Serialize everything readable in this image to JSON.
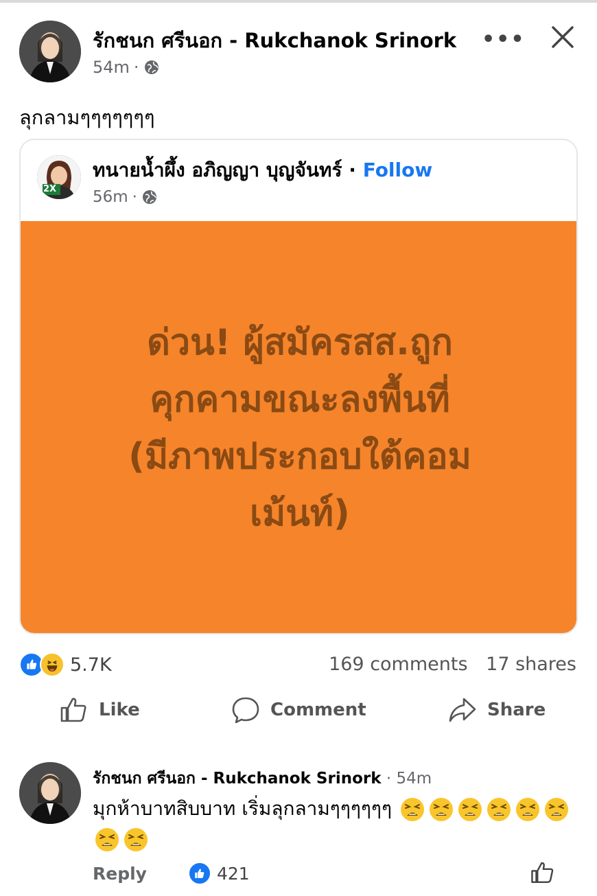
{
  "post": {
    "author": "รักชนก ศรีนอก - Rukchanok Srinork",
    "time": "54m",
    "separator": "·",
    "more_label": "•••",
    "text": "ลุกลามๆๆๆๆๆๆๆ"
  },
  "shared": {
    "author": "ทนายน้ำผึ้ง อภิญญา บุญจันทร์",
    "dot": " · ",
    "follow_label": "Follow",
    "time": "56m",
    "separator": "·",
    "badge": "2X",
    "image_text_lines": [
      "ด่วน! ผู้สมัครสส.ถูก",
      "คุกคามขณะลงพื้นที่",
      "(มีภาพประกอบใต้คอม",
      "เม้นท์)"
    ],
    "image_bg": "#f5842a",
    "image_text_color": "#8a4a14"
  },
  "reactions": {
    "count": "5.7K",
    "comments": "169 comments",
    "shares": "17 shares"
  },
  "actions": {
    "like": "Like",
    "comment": "Comment",
    "share": "Share"
  },
  "comment": {
    "author": "รักชนก ศรีนอก - Rukchanok Srinork",
    "time": " · 54m",
    "text": "มุกห้าบาทสิบบาท เริ่มลุกลามๆๆๆๆๆๆ",
    "emoji": "tired-face",
    "reply_label": "Reply",
    "like_count": "421"
  },
  "colors": {
    "accent": "#1877f2",
    "secondary_text": "#65676b"
  }
}
